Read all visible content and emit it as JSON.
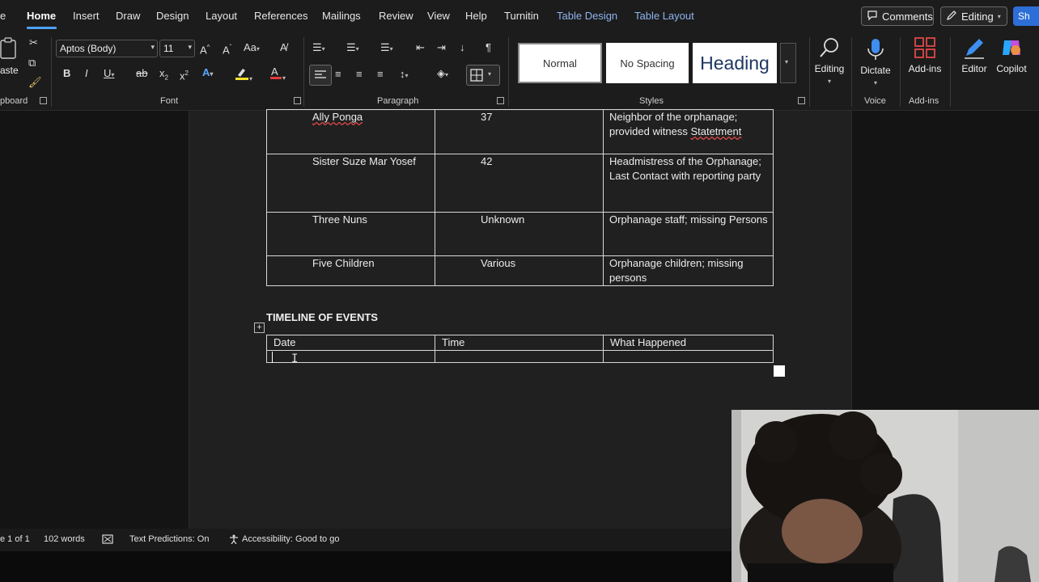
{
  "tabs": [
    "Home",
    "Insert",
    "Draw",
    "Design",
    "Layout",
    "References",
    "Mailings",
    "Review",
    "View",
    "Help",
    "Turnitin",
    "Table Design",
    "Table Layout"
  ],
  "tab_file_fragment": "e",
  "top_right": {
    "comments": "Comments",
    "editing": "Editing",
    "share_fragment": "Sh"
  },
  "ribbon": {
    "clipboard": {
      "paste_label": "aste",
      "group_label": "pboard"
    },
    "font": {
      "font_name": "Aptos (Body)",
      "font_size": "11",
      "group_label": "Font"
    },
    "paragraph": {
      "group_label": "Paragraph"
    },
    "styles": {
      "normal": "Normal",
      "no_spacing": "No Spacing",
      "heading": "Heading",
      "group_label": "Styles"
    },
    "editing": {
      "label": "Editing"
    },
    "voice": {
      "dictate": "Dictate",
      "group_label": "Voice"
    },
    "addins": {
      "label": "Add-ins",
      "group_label": "Add-ins"
    },
    "editor": "Editor",
    "copilot": "Copilot"
  },
  "document": {
    "persons_rows": [
      {
        "name": "Ally Ponga",
        "age": "37",
        "desc_a": "Neighbor of the orphanage; provided witness ",
        "desc_b": "Statetment"
      },
      {
        "name": "Sister Suze Mar Yosef",
        "age": "42",
        "desc": "Headmistress of the Orphanage; Last Contact with reporting party"
      },
      {
        "name": "Three Nuns",
        "age": "Unknown",
        "desc": "Orphanage staff; missing Persons"
      },
      {
        "name": "Five Children",
        "age": "Various",
        "desc": "Orphanage children; missing persons"
      }
    ],
    "timeline_title": "TIMELINE OF EVENTS",
    "timeline_headers": [
      "Date",
      "Time",
      "What Happened"
    ]
  },
  "status": {
    "page": "e 1 of 1",
    "words": "102 words",
    "text_predictions": "Text Predictions: On",
    "accessibility": "Accessibility: Good to go"
  },
  "colors": {
    "accent_blue": "#4ea1f5",
    "share_blue": "#2d6fd6",
    "font_color_red": "#e23b3b",
    "highlight_yellow": "#f5e12b"
  }
}
